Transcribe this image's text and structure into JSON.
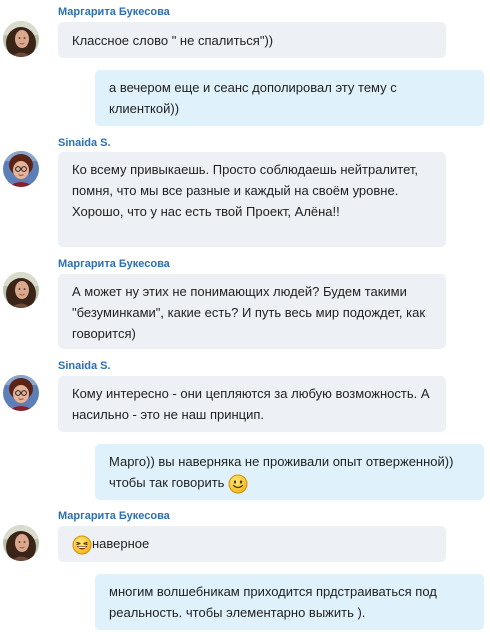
{
  "colors": {
    "sender_name": "#2b6fb5",
    "incoming_bubble": "#edf1f6",
    "outgoing_bubble": "#dff1fb"
  },
  "messages": [
    {
      "direction": "in",
      "sender": "Маргарита Букесова",
      "avatar": "avatar-margarita",
      "text": "Классное слово \" не спалиться\"))"
    },
    {
      "direction": "out",
      "text": "а вечером еще и сеанс дополировал эту тему с клиенткой))"
    },
    {
      "direction": "in",
      "sender": "Sinaida S.",
      "avatar": "avatar-sinaida",
      "text": "Ко всему привыкаешь. Просто соблюдаешь нейтралитет, помня, что мы все разные и каждый на своём уровне. Хорошо, что у нас есть твой Проект, Алёна!!"
    },
    {
      "direction": "in",
      "sender": "Маргарита Букесова",
      "avatar": "avatar-margarita",
      "text": "А может ну этих не понимающих людей? Будем такими \"безуминками\", какие есть? И путь весь мир подождет, как говорится)"
    },
    {
      "direction": "in",
      "sender": "Sinaida S.",
      "avatar": "avatar-sinaida",
      "text": "Кому интересно - они цепляются за любую возможность. А насильно - это не наш принцип."
    },
    {
      "direction": "out",
      "text": "Марго)) вы наверняка не проживали опыт отверженной)) чтобы так говорить",
      "trailing_emoji": "smile-emoji-icon"
    },
    {
      "direction": "in",
      "sender": "Маргарита Букесова",
      "avatar": "avatar-margarita",
      "text": "наверное",
      "leading_emoji": "laughing-emoji-icon"
    },
    {
      "direction": "out",
      "text": "многим волшебникам приходится прдстраиваться под реальность. чтобы элементарно выжить )."
    }
  ]
}
